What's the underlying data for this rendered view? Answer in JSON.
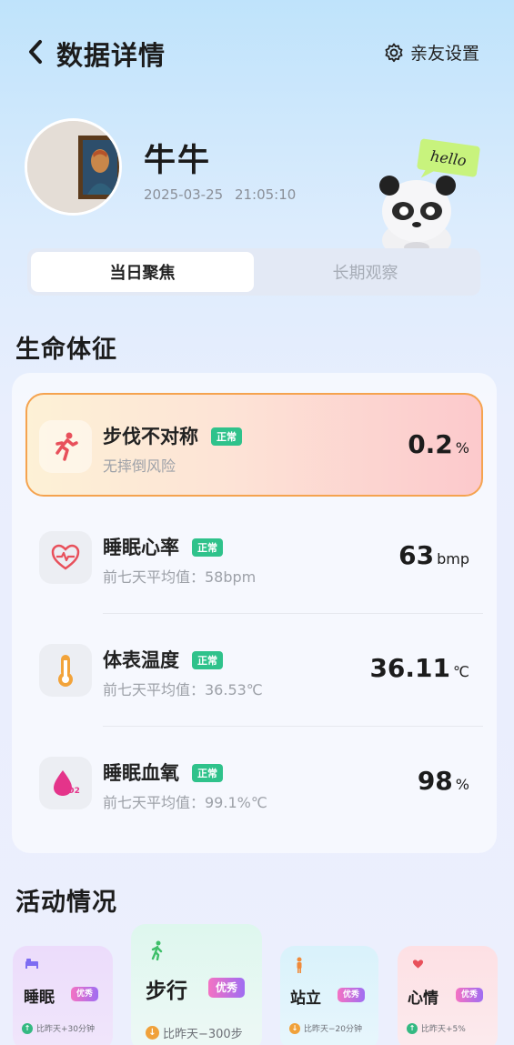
{
  "header": {
    "title": "数据详情",
    "settings_label": "亲友设置"
  },
  "profile": {
    "name": "牛牛",
    "timestamp": "2025-03-25   21:05:10",
    "mascot_text": "hello"
  },
  "tabs": [
    {
      "label": "当日聚焦",
      "active": true
    },
    {
      "label": "长期观察",
      "active": false
    }
  ],
  "vitals": {
    "title": "生命体征",
    "items": [
      {
        "name": "步伐不对称",
        "badge": "正常",
        "sub": "无摔倒风险",
        "value": "0.2",
        "unit": "%",
        "icon": "running-person-icon",
        "highlight": true
      },
      {
        "name": "睡眠心率",
        "badge": "正常",
        "sub": "前七天平均值：58bpm",
        "value": "63",
        "unit": "bmp",
        "icon": "heart-pulse-icon"
      },
      {
        "name": "体表温度",
        "badge": "正常",
        "sub": "前七天平均值：36.53℃",
        "value": "36.11",
        "unit": "℃",
        "icon": "thermometer-icon"
      },
      {
        "name": "睡眠血氧",
        "badge": "正常",
        "sub": "前七天平均值：99.1%℃",
        "value": "98",
        "unit": "%",
        "icon": "oxygen-drop-icon"
      }
    ]
  },
  "activity": {
    "title": "活动情况",
    "items": [
      {
        "name": "睡眠",
        "badge": "优秀",
        "delta": "比昨天+30分钟",
        "icon": "bed-icon",
        "delta_dir": "up"
      },
      {
        "name": "步行",
        "badge": "优秀",
        "delta": "比昨天−300步",
        "icon": "walking-icon",
        "delta_dir": "down"
      },
      {
        "name": "站立",
        "badge": "优秀",
        "delta": "比昨天−20分钟",
        "icon": "standing-person-icon",
        "delta_dir": "down"
      },
      {
        "name": "心情",
        "badge": "优秀",
        "delta": "比昨天+5%",
        "icon": "heart-icon",
        "delta_dir": "up"
      }
    ]
  },
  "colors": {
    "badge_green": "#2fc28b",
    "highlight_border": "#f5a34f",
    "accent_red": "#e8505b"
  }
}
